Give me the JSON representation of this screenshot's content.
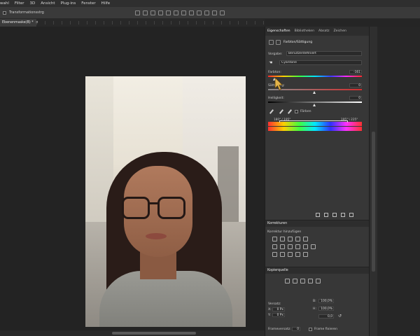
{
  "menubar": {
    "items": [
      "wahl",
      "Filter",
      "3D",
      "Ansicht",
      "Plug-ins",
      "Fenster",
      "Hilfe"
    ]
  },
  "options_bar": {
    "transform_label": "Transformationsstrg"
  },
  "document_tab": {
    "title": "Ebenenmaske(B) *"
  },
  "properties_panel": {
    "tabs": [
      "Eigenschaften",
      "Bibliotheken",
      "Absatz",
      "Zeichen"
    ],
    "active_tab": "Eigenschaften",
    "layer_type": "Farbton/Sättigung",
    "preset_label": "Vorgabe:",
    "preset_value": "Benutzerdefiniert",
    "range_value": "Cyantöne",
    "hue_label": "Farbton:",
    "hue_value": "-161",
    "saturation_label": "Sättigung:",
    "saturation_value": "0",
    "lightness_label": "Helligkeit:",
    "lightness_value": "0",
    "colorize_label": "Färben",
    "range_left": "180° / 195°",
    "range_right": "195° \\ 225°"
  },
  "adjustments_panel": {
    "title": "Korrekturen",
    "add_label": "Korrektur hinzufügen"
  },
  "libraries_panel": {
    "title": "Kopierquelle",
    "field_labels": [
      "Versatz:",
      "X:",
      "Y:",
      "B:",
      "H:"
    ],
    "field_values": [
      "0 Px",
      "0 Px",
      "100,0%",
      "100,0%",
      "0,0"
    ],
    "frame_offset_label": "Frameversatz:",
    "frame_offset_value": "0",
    "lock_frame_label": "Frame fixieren"
  },
  "colors": {
    "panel_bg": "#373737",
    "canvas_bg": "#232323",
    "menubar_bg": "#2f2f2f"
  }
}
